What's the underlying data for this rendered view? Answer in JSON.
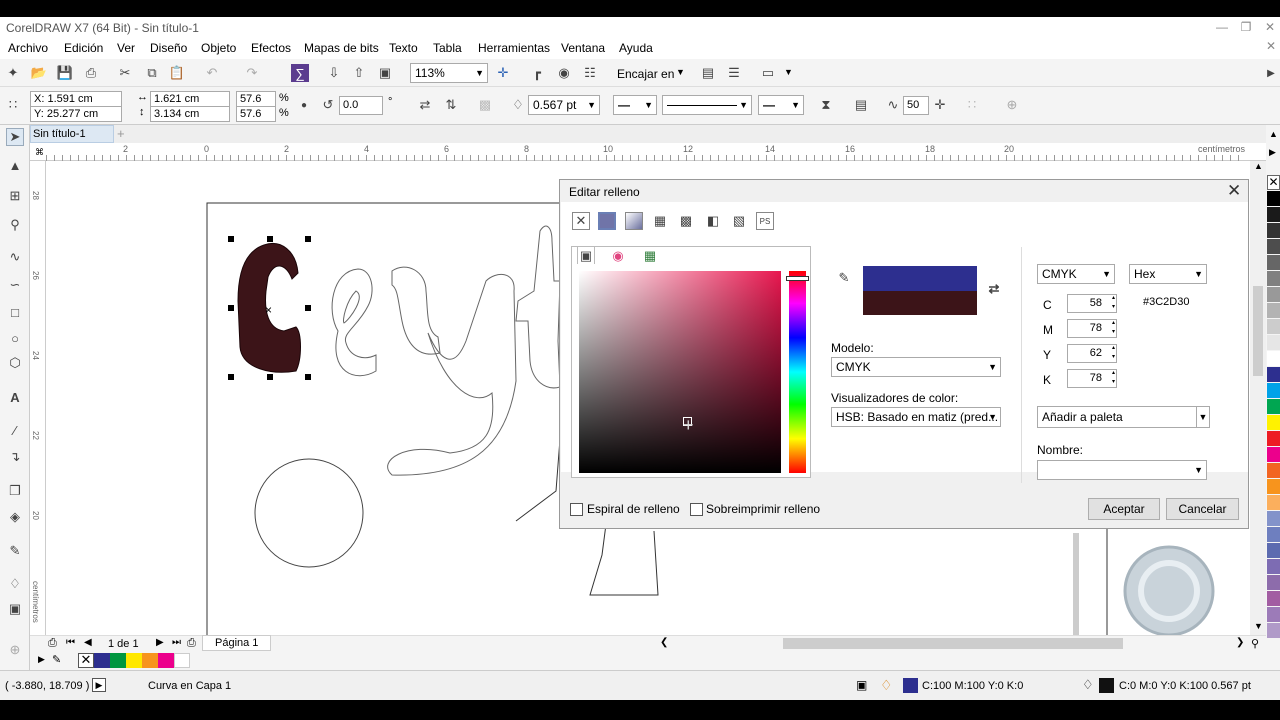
{
  "window": {
    "title": "CorelDRAW X7 (64 Bit) - Sin título-1"
  },
  "menu": [
    "Archivo",
    "Edición",
    "Ver",
    "Diseño",
    "Objeto",
    "Efectos",
    "Mapas de bits",
    "Texto",
    "Tabla",
    "Herramientas",
    "Ventana",
    "Ayuda"
  ],
  "toolbar": {
    "zoom": "113%",
    "snap_label": "Encajar en"
  },
  "propbar": {
    "x": "X: 1.591 cm",
    "y": "Y: 25.277 cm",
    "w": "1.621 cm",
    "h": "3.134 cm",
    "sx": "57.6",
    "sy": "57.6",
    "pct": "%",
    "rotation": "0.0",
    "deg": "°",
    "outline_width": "0.567 pt",
    "smooth": "50"
  },
  "doc": {
    "tab": "Sin título-1",
    "ruler_unit": "centímetros",
    "vruler_unit": "centímetros"
  },
  "ruler": {
    "h_ticks": [
      "2",
      "0",
      "2",
      "4",
      "6",
      "8",
      "10",
      "12",
      "14",
      "16",
      "18",
      "20"
    ],
    "v_ticks": [
      "28",
      "26",
      "24",
      "22",
      "20"
    ]
  },
  "pagenav": {
    "counter": "1 de 1",
    "page_tab": "Página 1"
  },
  "dialog": {
    "title": "Editar relleno",
    "model_label": "Modelo:",
    "model_value": "CMYK",
    "viewers_label": "Visualizadores de color:",
    "viewer_value": "HSB: Basado en matiz (pred...",
    "right_model": "CMYK",
    "right_format": "Hex",
    "hex": "#3C2D30",
    "c_label": "C",
    "c": "58",
    "m_label": "M",
    "m": "78",
    "y_label": "Y",
    "y": "62",
    "k_label": "K",
    "k": "78",
    "add_palette": "Añadir a paleta",
    "name_label": "Nombre:",
    "spiral": "Espiral de relleno",
    "overprint": "Sobreimprimir relleno",
    "ok": "Aceptar",
    "cancel": "Cancelar",
    "colors": {
      "old": "#2d2f8f",
      "new": "#3c1418"
    }
  },
  "status": {
    "coords": "( -3.880, 18.709 )",
    "object": "Curva en Capa 1",
    "fill": "C:100 M:100 Y:0 K:0",
    "outline": "C:0 M:0 Y:0 K:100  0.567 pt"
  },
  "colors": {
    "accent": "#2d2f8f",
    "shape_fill": "#3c1418"
  }
}
